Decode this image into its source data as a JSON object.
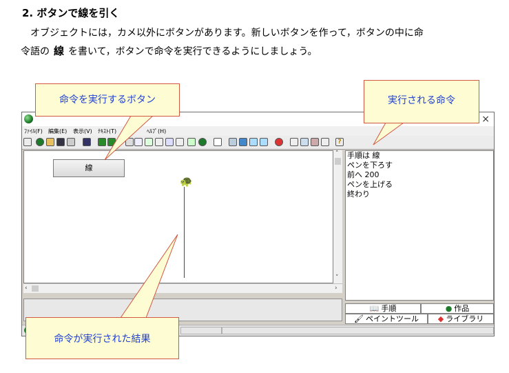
{
  "doc": {
    "heading": "2. ボタンで線を引く",
    "para_line1": "オブジェクトには，カメ以外にボタンがあります。新しいボタンを作って，ボタンの中に命",
    "para_line2_a": "令語の",
    "para_bold": "線",
    "para_line2_b": "を書いて，ボタンで命令を実行できるようにしましょう。"
  },
  "window": {
    "close": "×",
    "menu": [
      "ﾌｧｲﾙ(F)",
      "編集(E)",
      "表示(V)",
      "ﾃｷｽﾄ(T)",
      "ﾍﾙﾌﾟ(H)"
    ],
    "toolbar_help": "?"
  },
  "canvas": {
    "button_label": "線",
    "turtle": "🐢"
  },
  "editor": {
    "lines": [
      "手順は 線",
      "ペンを下ろす",
      "前へ 200",
      "ペンを上げる",
      "終わり"
    ]
  },
  "tabs": {
    "procedures": "手順",
    "works": "作品",
    "paint": "ペイントツール",
    "library": "ライブラリ"
  },
  "callouts": {
    "button": "命令を実行するボタン",
    "command": "実行される命令",
    "result": "命令が実行された結果"
  },
  "colors": {
    "callout_bg": "#fdfcd3",
    "callout_border": "#d2573f",
    "callout_text": "#1f3fd6"
  }
}
